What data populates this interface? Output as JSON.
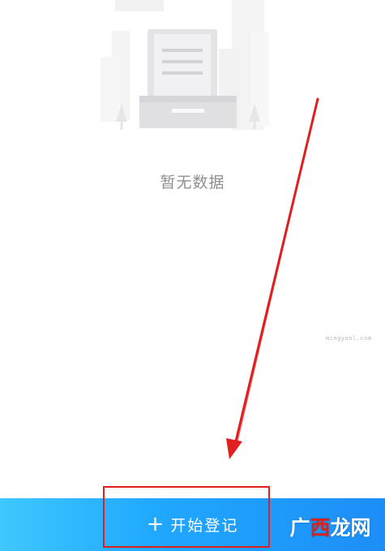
{
  "empty_state": {
    "message": "暂无数据",
    "illustration_icon": "document-tray-icon"
  },
  "watermark": {
    "text": "mingyanl.com"
  },
  "bottom_bar": {
    "plus_symbol": "+",
    "register_label": "开始登记"
  },
  "brand": {
    "part1": "广",
    "part2": "西",
    "part3": "龙网"
  },
  "colors": {
    "accent_start": "#3ec8ff",
    "accent_end": "#1d8ef7",
    "annotation": "#e02020"
  }
}
